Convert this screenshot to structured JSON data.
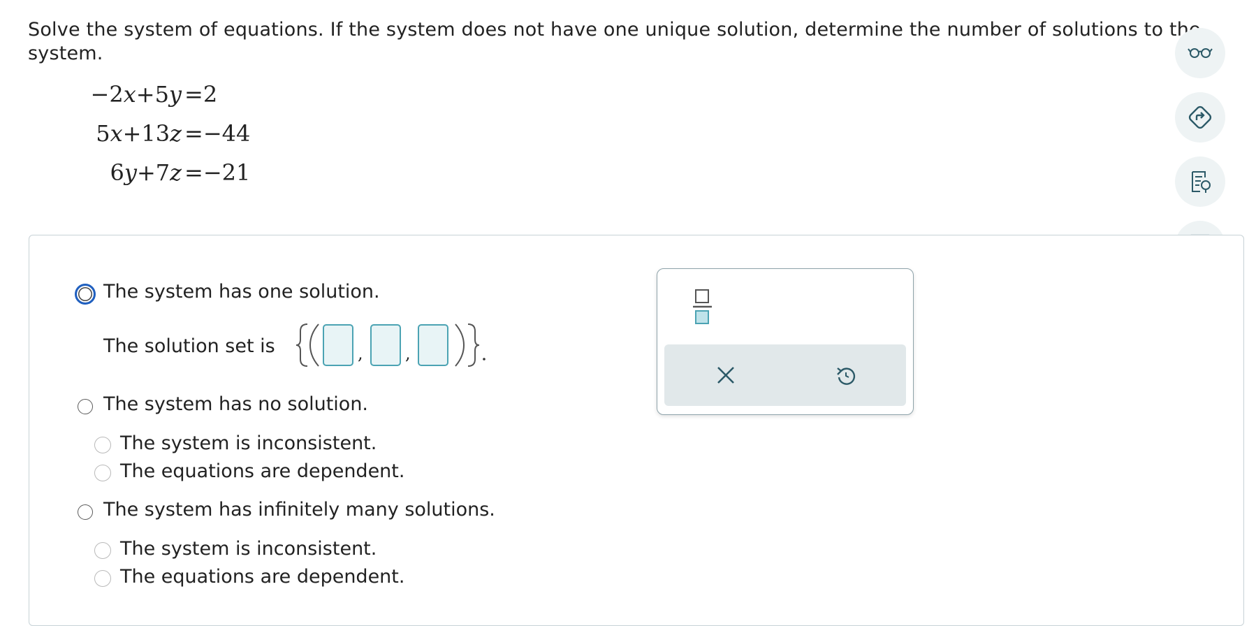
{
  "prompt": "Solve the system of equations. If the system does not have one unique solution, determine the number of solutions to the system.",
  "equations": [
    {
      "lhs": "−2x+5y",
      "rhs": "=2"
    },
    {
      "lhs": "5x+13z",
      "rhs": "=−44"
    },
    {
      "lhs": "6y+7z",
      "rhs": "=−21"
    }
  ],
  "tools": [
    "glasses-icon",
    "share-route-icon",
    "hint-bulb-icon",
    "textbook-icon"
  ],
  "options": {
    "one": "The system has one solution.",
    "solution_set_prefix": "The solution set is",
    "none": "The system has no solution.",
    "infinite": "The system has infinitely many solutions."
  },
  "sub_options": {
    "inconsistent": "The system is inconsistent.",
    "dependent": "The equations are dependent."
  },
  "palette": {
    "fraction_icon": "fraction-icon",
    "clear_icon": "close-icon",
    "undo_icon": "undo-icon"
  },
  "colors": {
    "focus": "#1f5fbf",
    "input_border": "#4ba3b3",
    "input_fill": "#e8f4f6",
    "tool_bg": "#eef3f4",
    "tool_icon": "#2b5967"
  }
}
